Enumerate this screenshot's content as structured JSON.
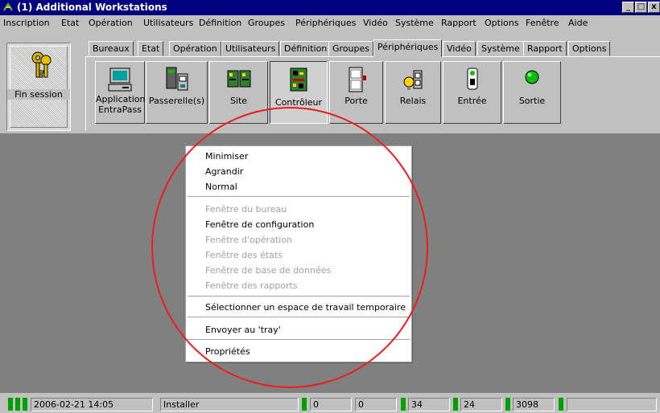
{
  "window": {
    "title": "(1) Additional Workstations",
    "min": "_",
    "max": "□",
    "close": "x"
  },
  "menu": [
    "Inscription",
    "Etat",
    "Opération",
    "Utilisateurs",
    "Définition",
    "Groupes",
    "Périphériques",
    "Vidéo",
    "Système",
    "Rapport",
    "Options",
    "Fenêtre",
    "Aide"
  ],
  "fin_session": "Fin session",
  "tabs": [
    "Bureaux",
    "Etat",
    "Opération",
    "Utilisateurs",
    "Définition",
    "Groupes",
    "Périphériques",
    "Vidéo",
    "Système",
    "Rapport",
    "Options"
  ],
  "active_tab": "Périphériques",
  "toolbar": {
    "application_1": "Application",
    "application_2": "EntraPass",
    "passerelles": "Passerelle(s)",
    "site": "Site",
    "controleur": "Contrôleur",
    "porte": "Porte",
    "relais": "Relais",
    "entree": "Entrée",
    "sortie": "Sortie"
  },
  "context_menu": {
    "minimiser": "Minimiser",
    "agrandir": "Agrandir",
    "normal": "Normal",
    "fenetre_bureau": "Fenêtre du bureau",
    "fenetre_configuration": "Fenêtre de configuration",
    "fenetre_operation": "Fenêtre d'opération",
    "fenetre_etats": "Fenêtre des états",
    "fenetre_bdd": "Fenêtre de base de données",
    "fenetre_rapports": "Fenêtre des rapports",
    "espace_temporaire": "Sélectionner un espace de travail temporaire",
    "envoyer_tray": "Envoyer au 'tray'",
    "proprietes": "Propriétés"
  },
  "status": {
    "datetime": "2006-02-21 14:05",
    "user": "Installer",
    "c1": "0",
    "c2": "0",
    "c3": "34",
    "c4": "24",
    "c5": "3098"
  },
  "colors": {
    "titlebar": "#000080",
    "face": "#c0c0c0",
    "workspace": "#808080",
    "annotation_circle": "#ee1c1c",
    "status_led": "#00a000"
  }
}
